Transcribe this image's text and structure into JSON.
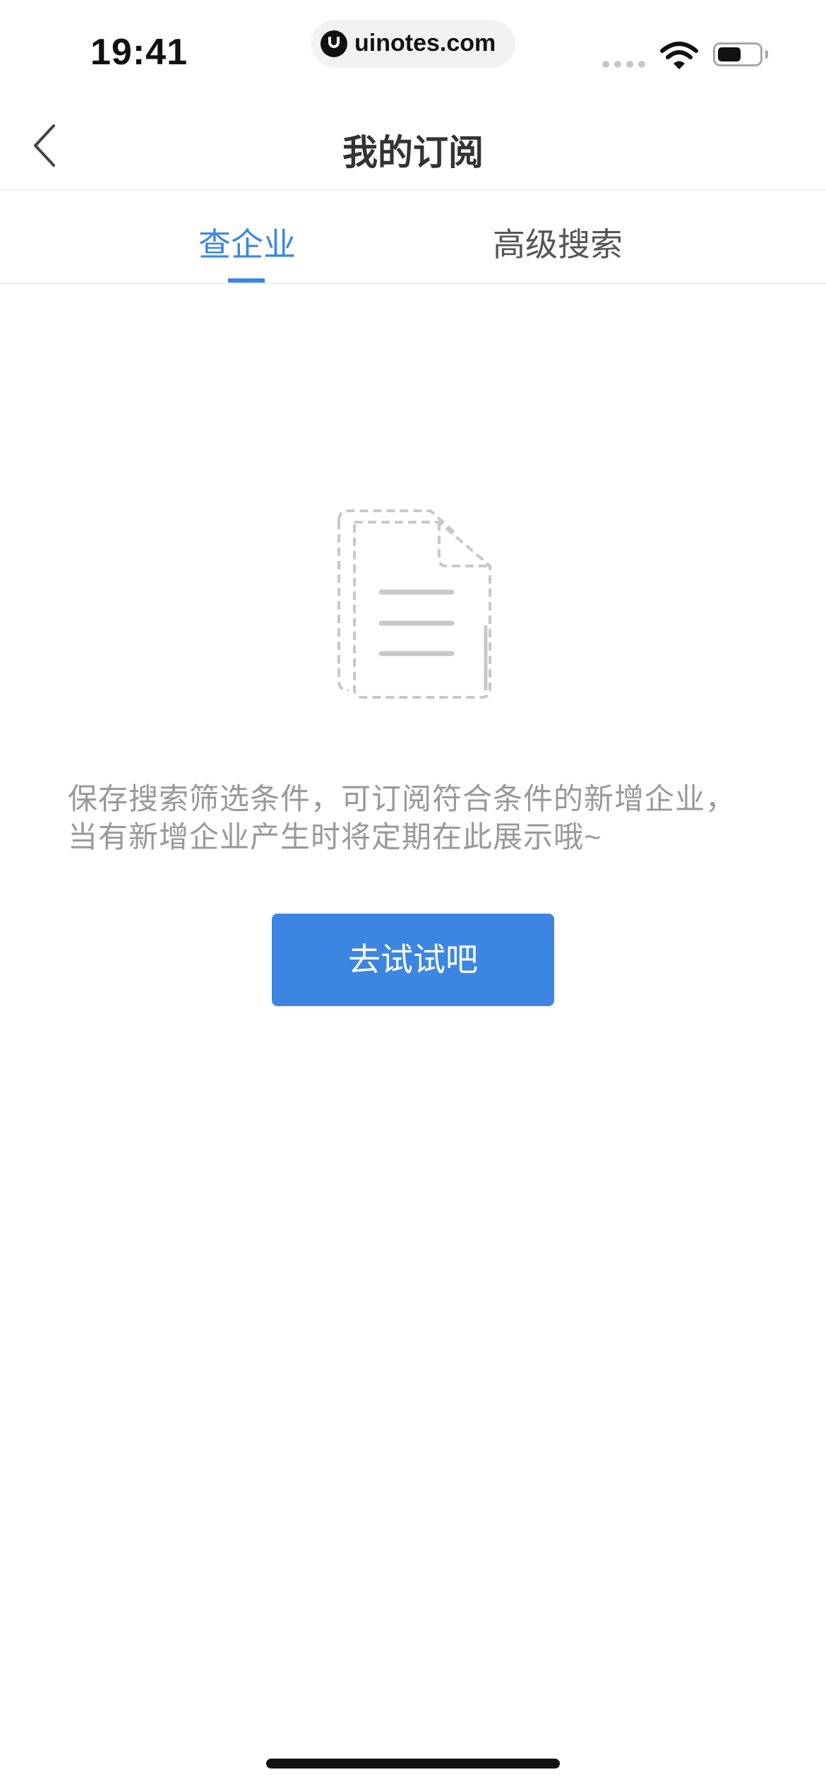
{
  "status_bar": {
    "time": "19:41",
    "url": "uinotes.com"
  },
  "nav": {
    "title": "我的订阅",
    "back_icon": "chevron-left-icon"
  },
  "tabs": [
    {
      "label": "查企业",
      "active": true
    },
    {
      "label": "高级搜索",
      "active": false
    }
  ],
  "empty_state": {
    "icon": "document-icon",
    "message": "保存搜索筛选条件，可订阅符合条件的新增企业，当有新增企业产生时将定期在此展示哦~",
    "button_label": "去试试吧"
  },
  "colors": {
    "accent": "#3c86e2",
    "title_text": "#333333",
    "muted_text": "#999999",
    "icon_stroke": "#c8c8c8"
  }
}
